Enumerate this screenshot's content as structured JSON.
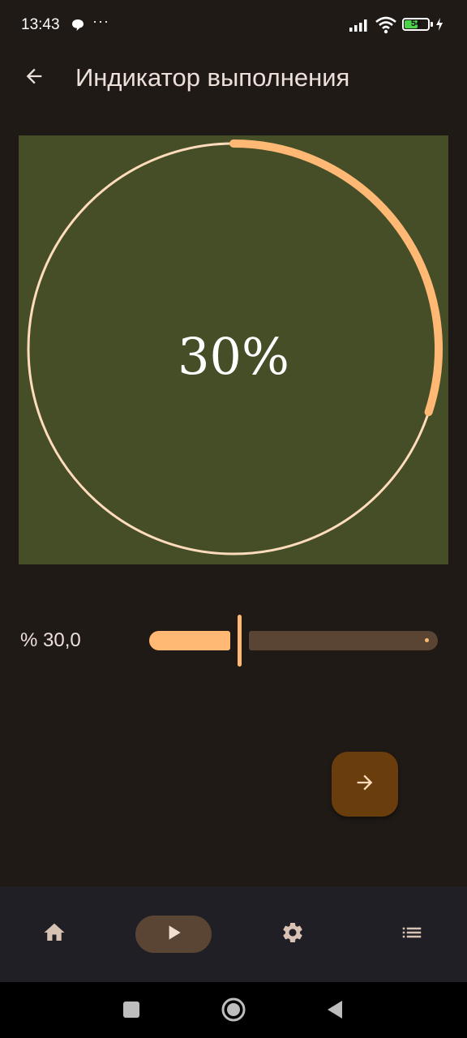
{
  "status_bar": {
    "time": "13:43",
    "more": "···",
    "battery_level": "54",
    "battery_color": "#4bd34b",
    "icons": [
      "chat-bubble-icon",
      "signal-icon",
      "wifi-icon",
      "battery-icon",
      "charging-icon"
    ]
  },
  "app_bar": {
    "title": "Индикатор выполнения",
    "back_icon": "arrow-back-icon"
  },
  "progress": {
    "value": 0.3,
    "label": "30%",
    "track_color": "#ffdcbc",
    "indicator_color": "#ffb974",
    "background_color": "#454e27"
  },
  "slider": {
    "label": "% 30,0",
    "value": 30.0,
    "min": 0,
    "max": 100,
    "active_color": "#ffb974",
    "inactive_color": "#5a4433"
  },
  "fab": {
    "icon": "arrow-forward-icon",
    "color": "#6a3d0c"
  },
  "bottom_nav": {
    "items": [
      {
        "icon": "home-icon",
        "active": false
      },
      {
        "icon": "play-icon",
        "active": true
      },
      {
        "icon": "gear-icon",
        "active": false
      },
      {
        "icon": "list-icon",
        "active": false
      }
    ]
  },
  "system_nav": {
    "buttons": [
      "recents-square-icon",
      "home-circle-icon",
      "back-triangle-icon"
    ]
  }
}
